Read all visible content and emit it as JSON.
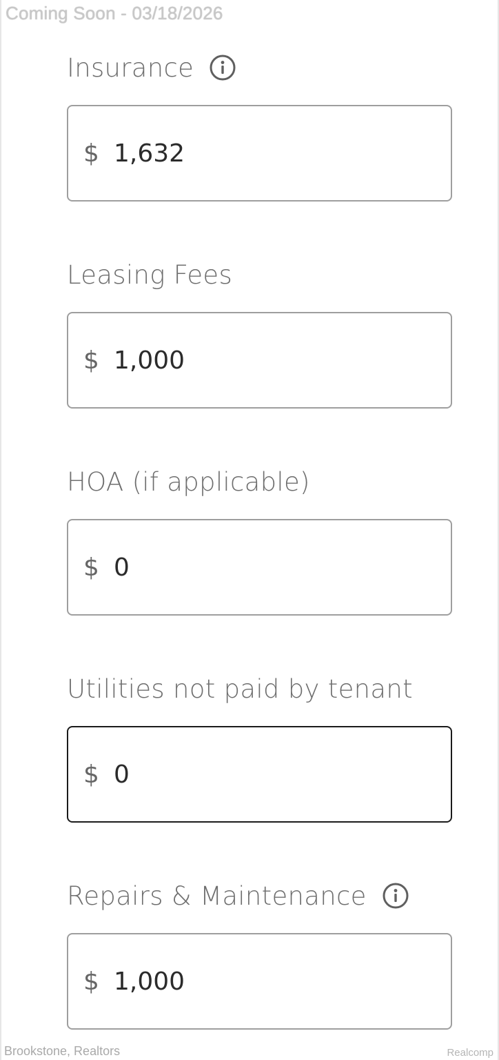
{
  "watermark": {
    "top": "Coming Soon - 03/18/2026",
    "bottom_left": "Brookstone, Realtors",
    "bottom_right": "Realcomp"
  },
  "fields": [
    {
      "label": "Insurance",
      "currency": "$",
      "value": "1,632",
      "has_info_icon": true,
      "focused": false
    },
    {
      "label": "Leasing Fees",
      "currency": "$",
      "value": "1,000",
      "has_info_icon": false,
      "focused": false
    },
    {
      "label": "HOA (if applicable)",
      "currency": "$",
      "value": "0",
      "has_info_icon": false,
      "focused": false
    },
    {
      "label": "Utilities not paid by tenant",
      "currency": "$",
      "value": "0",
      "has_info_icon": false,
      "focused": true
    },
    {
      "label": "Repairs & Maintenance",
      "currency": "$",
      "value": "1,000",
      "has_info_icon": true,
      "focused": false
    }
  ],
  "icons": {
    "info": "info-circle-icon"
  },
  "colors": {
    "label_text": "#6e6e6e",
    "value_text": "#2b2b2b",
    "input_border": "#9e9e9e",
    "input_border_focused": "#1a1a1a"
  }
}
